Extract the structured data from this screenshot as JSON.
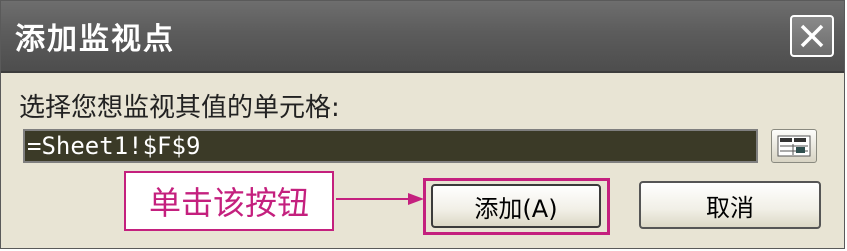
{
  "dialog": {
    "title": "添加监视点",
    "prompt": "选择您想监视其值的单元格:",
    "reference_value": "=Sheet1!$F$9",
    "add_label": "添加(A)",
    "cancel_label": "取消"
  },
  "annotation": {
    "callout_text": "单击该按钮",
    "color": "#c4207e"
  },
  "icons": {
    "close": "close-icon",
    "collapse": "range-select-icon"
  },
  "colors": {
    "titlebar": "#5c5c5c",
    "dialog_bg": "#e8e4d4",
    "input_bg": "#3b3a27"
  }
}
